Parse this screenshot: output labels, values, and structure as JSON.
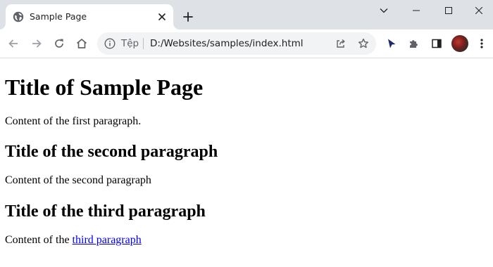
{
  "browser": {
    "tab": {
      "title": "Sample Page"
    },
    "omnibox": {
      "scheme_label": "Tệp",
      "url": "D:/Websites/samples/index.html"
    },
    "icons": [
      "page-favicon-icon",
      "close-icon",
      "plus-icon",
      "chevron-down-icon",
      "minimize-icon",
      "maximize-icon",
      "close-window-icon",
      "back-arrow-icon",
      "forward-arrow-icon",
      "reload-icon",
      "home-icon",
      "info-icon",
      "share-icon",
      "star-icon",
      "cursor-extension-icon",
      "puzzle-icon",
      "side-panel-icon",
      "kebab-menu-icon"
    ]
  },
  "page": {
    "heading": "Title of Sample Page",
    "paragraph1": "Content of the first paragraph.",
    "heading2": "Title of the second paragraph",
    "paragraph2": "Content of the second paragraph",
    "heading3": "Title of the third paragraph",
    "paragraph3_prefix": "Content of the ",
    "paragraph3_link": "third paragraph"
  },
  "colors": {
    "tabstrip": "#dee1e6",
    "omnibox": "#f1f3f4",
    "link": "#0000ee",
    "icon": "#5f6368"
  }
}
